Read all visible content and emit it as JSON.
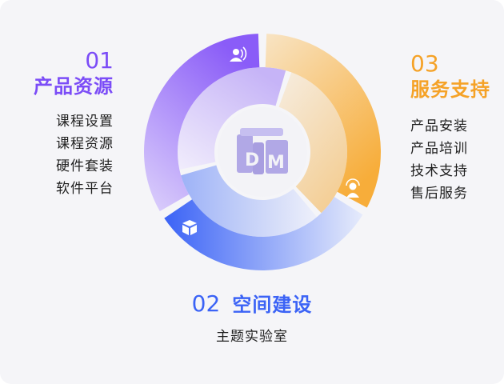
{
  "segments": [
    {
      "number": "01",
      "title": "产品资源",
      "items": [
        "课程设置",
        "课程资源",
        "硬件套装",
        "软件平台"
      ],
      "color": "#7b4cf7",
      "icon": "user-voice-icon"
    },
    {
      "number": "02",
      "title": "空间建设",
      "items": [
        "主题实验室"
      ],
      "color": "#3b63f6",
      "icon": "cube-icon"
    },
    {
      "number": "03",
      "title": "服务支持",
      "items": [
        "产品安装",
        "产品培训",
        "技术支持",
        "售后服务"
      ],
      "color": "#f5a227",
      "icon": "headset-user-icon"
    }
  ],
  "center_logo": "DM"
}
